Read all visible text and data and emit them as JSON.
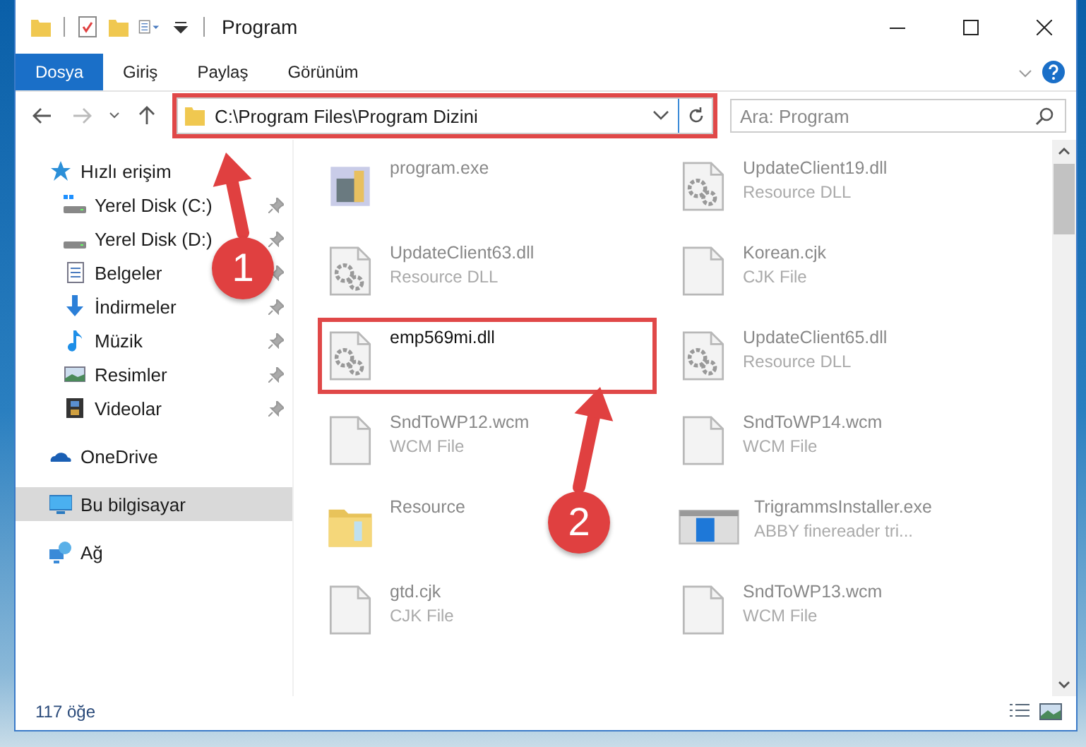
{
  "window": {
    "title": "Program"
  },
  "ribbon_tabs": [
    {
      "label": "Dosya",
      "selected": true
    },
    {
      "label": "Giriş",
      "selected": false
    },
    {
      "label": "Paylaş",
      "selected": false
    },
    {
      "label": "Görünüm",
      "selected": false
    }
  ],
  "address_bar": {
    "path": "C:\\Program Files\\Program Dizini",
    "highlighted": true
  },
  "search": {
    "placeholder": "Ara: Program"
  },
  "sidebar": {
    "items": [
      {
        "label": "Hızlı erişim",
        "kind": "quick",
        "selected": false,
        "children": [
          {
            "label": "Yerel Disk (C:)",
            "kind": "drive-c",
            "pinned": true,
            "selected": false
          },
          {
            "label": "Yerel Disk (D:)",
            "kind": "drive",
            "pinned": true,
            "selected": false
          },
          {
            "label": "Belgeler",
            "kind": "docs",
            "pinned": true,
            "selected": false
          },
          {
            "label": "İndirmeler",
            "kind": "downloads",
            "pinned": true,
            "selected": false
          },
          {
            "label": "Müzik",
            "kind": "music",
            "pinned": true,
            "selected": false
          },
          {
            "label": "Resimler",
            "kind": "pictures",
            "pinned": true,
            "selected": false
          },
          {
            "label": "Videolar",
            "kind": "videos",
            "pinned": true,
            "selected": false
          }
        ]
      },
      {
        "label": "OneDrive",
        "kind": "cloud",
        "selected": false
      },
      {
        "label": "Bu bilgisayar",
        "kind": "pc",
        "selected": true
      },
      {
        "label": "Ağ",
        "kind": "network",
        "selected": false
      }
    ]
  },
  "files": [
    {
      "name": "program.exe",
      "kind": "exe",
      "highlighted": false
    },
    {
      "name": "UpdateClient19.dll",
      "type": "Resource DLL",
      "kind": "dll",
      "highlighted": false
    },
    {
      "name": "UpdateClient63.dll",
      "type": "Resource DLL",
      "kind": "dll",
      "highlighted": false
    },
    {
      "name": "Korean.cjk",
      "type": "CJK File",
      "kind": "file",
      "highlighted": false
    },
    {
      "name": "emp569mi.dll",
      "kind": "dll",
      "highlighted": true
    },
    {
      "name": "UpdateClient65.dll",
      "type": "Resource DLL",
      "kind": "dll",
      "highlighted": false
    },
    {
      "name": "SndToWP12.wcm",
      "type": "WCM File",
      "kind": "file",
      "highlighted": false
    },
    {
      "name": "SndToWP14.wcm",
      "type": "WCM File",
      "kind": "file",
      "highlighted": false
    },
    {
      "name": "Resource",
      "kind": "folder",
      "highlighted": false
    },
    {
      "name": "TrigrammsInstaller.exe",
      "type": "ABBY finereader tri...",
      "kind": "installer",
      "highlighted": false
    },
    {
      "name": "gtd.cjk",
      "type": "CJK File",
      "kind": "file",
      "highlighted": false
    },
    {
      "name": "SndToWP13.wcm",
      "type": "WCM File",
      "kind": "file",
      "highlighted": false
    }
  ],
  "status_bar": {
    "item_count": "117 öğe"
  },
  "callouts": [
    {
      "label": "1"
    },
    {
      "label": "2"
    }
  ]
}
